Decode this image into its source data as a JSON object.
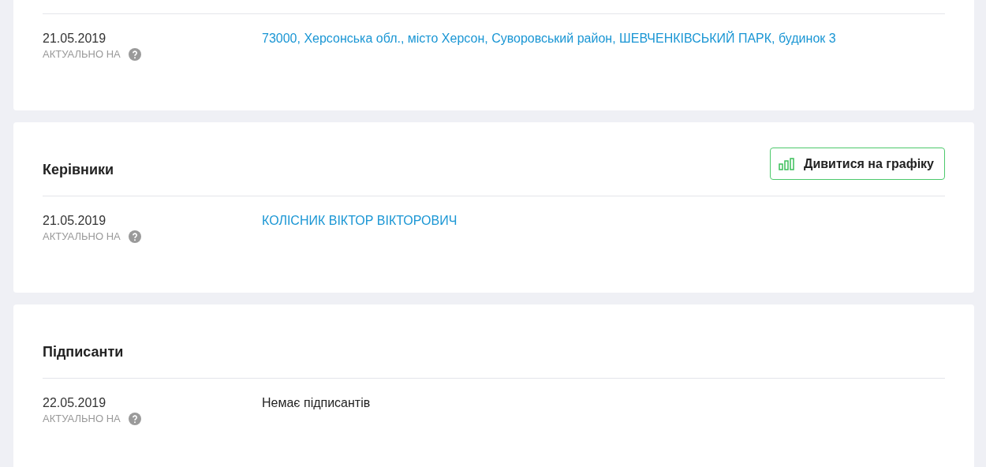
{
  "sections": [
    {
      "rows": [
        {
          "date": "21.05.2019",
          "date_label": "АКТУАЛЬНО НА",
          "kind": "link",
          "value": "73000, Херсонська обл., місто Херсон, Суворовський район, ШЕВЧЕНКІВСЬКИЙ ПАРК, будинок 3"
        }
      ]
    },
    {
      "title": "Керівники",
      "button": "Дивитися на графіку",
      "rows": [
        {
          "date": "21.05.2019",
          "date_label": "АКТУАЛЬНО НА",
          "kind": "link",
          "value": "КОЛІСНИК ВІКТОР ВІКТОРОВИЧ"
        }
      ]
    },
    {
      "title": "Підписанти",
      "rows": [
        {
          "date": "22.05.2019",
          "date_label": "АКТУАЛЬНО НА",
          "kind": "text",
          "value": "Немає підписантів"
        }
      ]
    }
  ]
}
